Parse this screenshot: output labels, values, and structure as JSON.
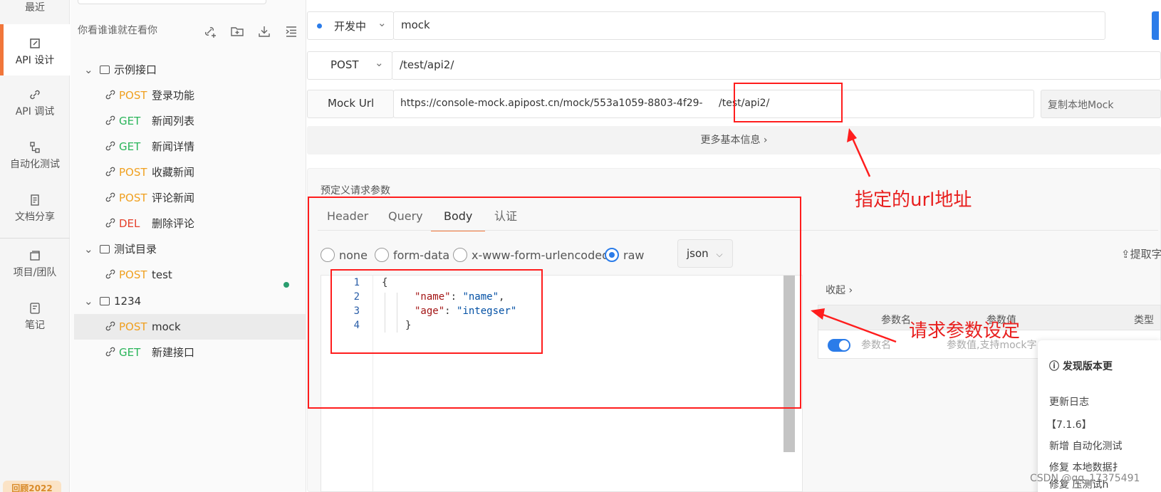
{
  "rail": {
    "items": [
      {
        "label": "最近"
      },
      {
        "label": "API 设计"
      },
      {
        "label": "API 调试"
      },
      {
        "label": "自动化测试"
      },
      {
        "label": "文档分享"
      },
      {
        "label": "项目/团队"
      },
      {
        "label": "笔记"
      }
    ],
    "badge": "回顾2022"
  },
  "tree": {
    "header": "你看谁谁就在看你",
    "folders": [
      {
        "name": "示例接口"
      },
      {
        "name": "测试目录"
      },
      {
        "name": "1234"
      }
    ],
    "apis": [
      {
        "method": "POST",
        "name": "登录功能"
      },
      {
        "method": "GET",
        "name": "新闻列表"
      },
      {
        "method": "GET",
        "name": "新闻详情"
      },
      {
        "method": "POST",
        "name": "收藏新闻"
      },
      {
        "method": "POST",
        "name": "评论新闻"
      },
      {
        "method": "DEL",
        "name": "删除评论"
      },
      {
        "method": "POST",
        "name": "test"
      },
      {
        "method": "POST",
        "name": "mock"
      },
      {
        "method": "GET",
        "name": "新建接口"
      }
    ]
  },
  "main": {
    "status": "开发中",
    "api_name": "mock",
    "method": "POST",
    "path": "/test/api2/",
    "mock_label": "Mock Url",
    "mock_url": "https://console-mock.apipost.cn/mock/553a1059-8803-4f29-",
    "mock_path": "/test/api2/",
    "copy_button": "复制本地Mock",
    "more_info": "更多基本信息",
    "section_title": "预定义请求参数",
    "tabs": [
      "Header",
      "Query",
      "Body",
      "认证"
    ],
    "body_types": [
      "none",
      "form-data",
      "x-www-form-urlencoded",
      "raw"
    ],
    "format": "json",
    "extract": "提取字",
    "editor": {
      "line_numbers": [
        "1",
        "2",
        "3",
        "4"
      ],
      "lines": [
        "{",
        "\"name\": \"name\",",
        "\"age\": \"integser\"",
        "}"
      ],
      "key1": "\"name\"",
      "val1": "\"name\"",
      "key2": "\"age\"",
      "val2": "\"integser\""
    },
    "collapse": "收起",
    "table": {
      "headers": [
        "参数名",
        "参数值",
        "类型"
      ],
      "name_placeholder": "参数名",
      "value_placeholder": "参数值,支持mock字"
    },
    "popup": {
      "title": "发现版本更",
      "changelog": "更新日志",
      "version": "【7.1.6】",
      "line1": "新增 自动化测试",
      "line2": "修复 本地数据扌",
      "line3": "修复 压测试h"
    }
  },
  "annotations": {
    "url_note": "指定的url地址",
    "param_note": "请求参数设定",
    "watermark": "CSDN @qq_17375491"
  },
  "colors": {
    "accent": "#f1763a",
    "primary": "#2b7ce9",
    "post": "#f0a020",
    "get": "#2ab55a",
    "del": "#e5402b",
    "annotation": "#ff1d1d"
  }
}
